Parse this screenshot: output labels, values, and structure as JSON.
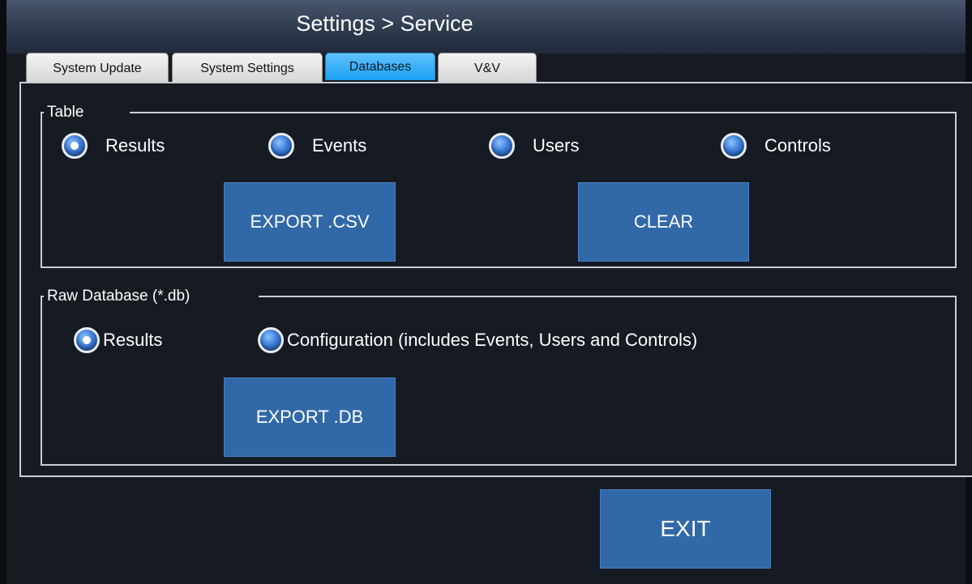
{
  "header": {
    "title": "Settings > Service"
  },
  "tabs": [
    {
      "label": "System Update",
      "active": false
    },
    {
      "label": "System Settings",
      "active": false
    },
    {
      "label": "Databases",
      "active": true
    },
    {
      "label": "V&V",
      "active": false
    }
  ],
  "table_group": {
    "legend": "Table",
    "options": [
      {
        "label": "Results",
        "checked": true
      },
      {
        "label": "Events",
        "checked": false
      },
      {
        "label": "Users",
        "checked": false
      },
      {
        "label": "Controls",
        "checked": false
      }
    ],
    "export_label": "EXPORT .CSV",
    "clear_label": "CLEAR"
  },
  "raw_group": {
    "legend": "Raw Database (*.db)",
    "options": [
      {
        "label": "Results",
        "checked": true
      },
      {
        "label": "Configuration (includes Events, Users and Controls)",
        "checked": false
      }
    ],
    "export_label": "EXPORT .DB"
  },
  "footer": {
    "exit_label": "EXIT"
  },
  "colors": {
    "button": "#3169a8",
    "active_tab": "#1aa1f0",
    "background": "#161a22"
  }
}
